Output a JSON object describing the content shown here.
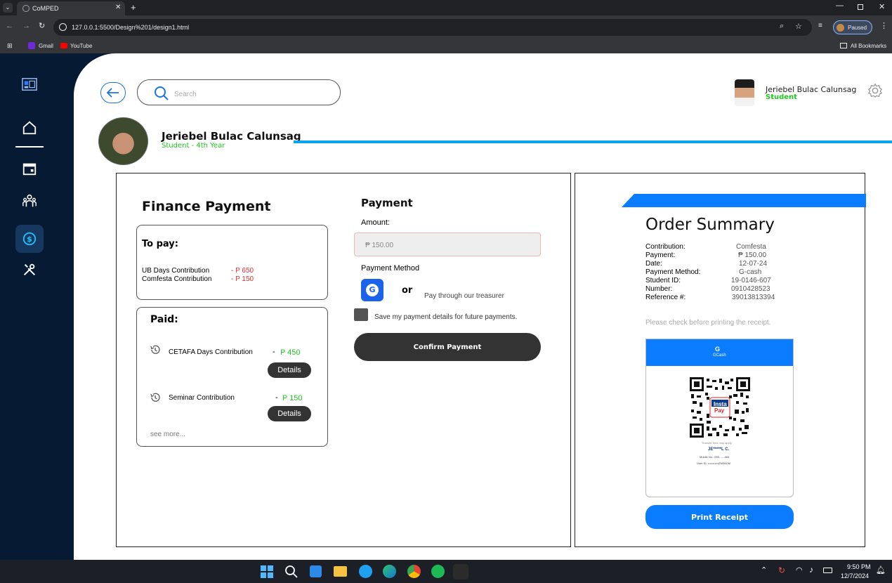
{
  "browser": {
    "tab_title": "CoMPED",
    "url": "127.0.0.1:5500/Design%201/design1.html",
    "profile_status": "Paused",
    "bookmarks": [
      "Gmail",
      "YouTube"
    ],
    "all_bookmarks": "All Bookmarks"
  },
  "header": {
    "search_placeholder": "Search",
    "user_name": "Jeriebel Bulac Calunsag",
    "user_role": "Student"
  },
  "profile": {
    "name": "Jeriebel Bulac Calunsag",
    "subtitle": "Student - 4th Year"
  },
  "finance": {
    "title": "Finance Payment",
    "to_pay_title": "To pay:",
    "to_pay_items": [
      {
        "label": "UB Days Contribution",
        "amount": "- P 650"
      },
      {
        "label": "Comfesta Contribution",
        "amount": "- P 150"
      }
    ],
    "paid_title": "Paid:",
    "paid_items": [
      {
        "label": "CETAFA Days Contribution",
        "dash": "-",
        "amount": "P 450",
        "button": "Details"
      },
      {
        "label": "Seminar Contribution",
        "dash": "-",
        "amount": "P 150",
        "button": "Details"
      }
    ],
    "see_more": "see more..."
  },
  "payment": {
    "title": "Payment",
    "amount_label": "Amount:",
    "amount_value": "₱ 150.00",
    "method_label": "Payment Method",
    "or_label": "or",
    "treasurer_label": "Pay through our treasurer",
    "save_details": "Save my payment details for future payments.",
    "confirm_button": "Confirm Payment"
  },
  "order_summary": {
    "title": "Order Summary",
    "rows": [
      {
        "key": "Contribution:",
        "value": "Comfesta"
      },
      {
        "key": "Payment:",
        "value": "₱ 150.00"
      },
      {
        "key": "Date:",
        "value": "12-07-24"
      },
      {
        "key": "Payment Method:",
        "value": "G-cash"
      },
      {
        "key": "Student ID:",
        "value": "19-0146-607"
      },
      {
        "key": "Number:",
        "value": "0910428523"
      },
      {
        "key": "Reference #:",
        "value": "39013813394"
      }
    ],
    "note": "Please check before printing the receipt.",
    "gcash_label": "GCash",
    "qr_badge_top": "Insta",
    "qr_badge_bottom": "Pay",
    "qr_fine": "Transfer fees may apply.",
    "qr_name": "JE*****L C.",
    "qr_mobile": "Mobile No.: 095- ----084",
    "qr_userid": "User ID: •••••••••••ZM0ADM",
    "print_button": "Print Receipt"
  },
  "taskbar": {
    "time": "9:50 PM",
    "date": "12/7/2024"
  },
  "colors": {
    "accent_blue": "#0a7cff",
    "nav_bg": "#071a33",
    "green": "#1fc81f",
    "red": "#e52b2b"
  }
}
